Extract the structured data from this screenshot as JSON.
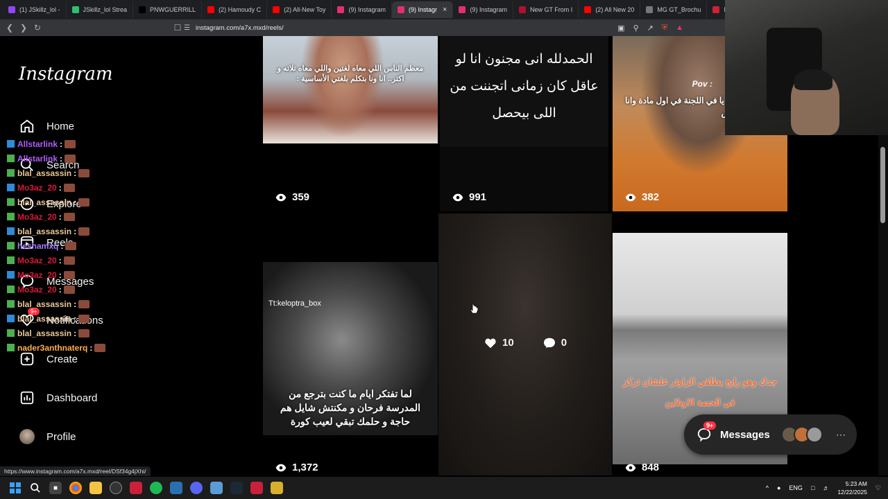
{
  "browser": {
    "tabs": [
      {
        "label": "(1) JSkillz_lol -",
        "color": "#9146ff"
      },
      {
        "label": "JSkillz_lol Strea",
        "color": "#2fbf71"
      },
      {
        "label": "PNWGUERRILL",
        "color": "#000000"
      },
      {
        "label": "(2) Hamoudy C",
        "color": "#ff0000"
      },
      {
        "label": "(2) All-New Toy",
        "color": "#ff0000"
      },
      {
        "label": "(9) Instagram",
        "color": "#e1306c"
      },
      {
        "label": "(9) Instagr",
        "color": "#e1306c",
        "active": true
      },
      {
        "label": "(9) Instagram",
        "color": "#e1306c"
      },
      {
        "label": "New GT From I",
        "color": "#b01030"
      },
      {
        "label": "(2) All New 20",
        "color": "#ff0000"
      },
      {
        "label": "MG GT_Brochu",
        "color": "#777777"
      },
      {
        "label": "MG Offers | MG",
        "color": "#cc2233"
      }
    ],
    "url": "instagram.com/a7x.mxd/reels/",
    "status_url": "https://www.instagram.com/a7x.mxd/reel/DSf34g4jXhi/"
  },
  "instagram": {
    "logo": "Instagram",
    "nav": [
      {
        "label": "Home",
        "icon": "home-icon"
      },
      {
        "label": "Search",
        "icon": "search-icon"
      },
      {
        "label": "Explore",
        "icon": "explore-icon"
      },
      {
        "label": "Reels",
        "icon": "reels-icon"
      },
      {
        "label": "Messages",
        "icon": "messenger-icon"
      },
      {
        "label": "Notifications",
        "icon": "heart-icon"
      },
      {
        "label": "Create",
        "icon": "plus-icon"
      },
      {
        "label": "Dashboard",
        "icon": "dashboard-icon"
      },
      {
        "label": "Profile",
        "icon": "avatar"
      }
    ],
    "messages_badge": "9+",
    "reels": [
      {
        "views": "359",
        "caption": "معظم الناس اللي معاه لغتين واللي معاه تلاته و اكتر..  انا ونا بتكلم بلغتي الأساسية :"
      },
      {
        "views": "991",
        "caption": "الحمدلله انى مجنون انا لو عاقل كان زمانى اتجننت من اللى بيحصل"
      },
      {
        "views": "382",
        "caption": "قاعد ورايا في اللجنة في اول مادة وانا معرفوش"
      },
      {
        "views": "1,372",
        "caption": "لما تفتكر ايام ما كنت بترجع من المدرسة فرحان و مكنتش شايل هم حاجة و حلمك تبقي لعيب كورة",
        "watermark": "Tt:keloptra_box"
      },
      {
        "likes": "10",
        "comments": "0"
      },
      {
        "views": "848",
        "caption": "جدك وهو رايح يطلقي الزاوتر علشان تركز في الحصة الاونلاين"
      }
    ],
    "messages_pill": {
      "label": "Messages",
      "badge": "9+"
    }
  },
  "chat": [
    {
      "user": "Allstarlink",
      "color": "#b05bff"
    },
    {
      "user": "Allstarlink",
      "color": "#b05bff"
    },
    {
      "user": "blal_assassin",
      "color": "#e8c79a"
    },
    {
      "user": "Mo3az_20",
      "color": "#d81b3a"
    },
    {
      "user": "blal_assassin",
      "color": "#e8c79a"
    },
    {
      "user": "Mo3az_20",
      "color": "#d81b3a"
    },
    {
      "user": "blal_assassin",
      "color": "#e8c79a"
    },
    {
      "user": "heshamxq",
      "color": "#a97bff"
    },
    {
      "user": "Mo3az_20",
      "color": "#d81b3a"
    },
    {
      "user": "Mo3az_20",
      "color": "#d81b3a"
    },
    {
      "user": "Mo3az_20",
      "color": "#d81b3a"
    },
    {
      "user": "blal_assassin",
      "color": "#e8c79a"
    },
    {
      "user": "blal_assassin",
      "color": "#e8c79a"
    },
    {
      "user": "blal_assassin",
      "color": "#e8c79a"
    },
    {
      "user": "nader3anthnaterq",
      "color": "#ffae4a"
    }
  ],
  "taskbar": {
    "lang": "ENG",
    "time": "5:23 AM",
    "date": "12/22/2025"
  }
}
